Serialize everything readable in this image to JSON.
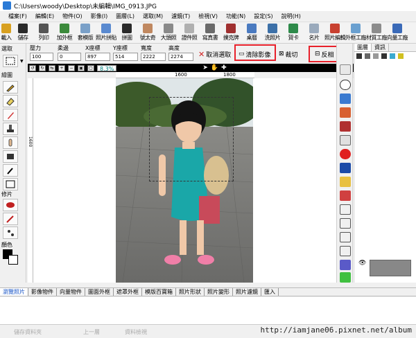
{
  "window": {
    "title": "C:\\Users\\woody\\Desktop\\未編輯\\IMG_0913.JPG"
  },
  "menu": [
    "檔案(F)",
    "編輯(E)",
    "物件(O)",
    "影像(I)",
    "圖層(L)",
    "選取(M)",
    "濾鏡(T)",
    "檢視(V)",
    "功能(N)",
    "設定(S)",
    "說明(H)"
  ],
  "toolbar": [
    {
      "label": "載入",
      "color": "#d8a020"
    },
    {
      "label": "儲存",
      "color": "#2a2a2a"
    },
    {
      "label": "列印",
      "color": "#555555"
    },
    {
      "label": "加外框",
      "color": "#3c8a3c"
    },
    {
      "label": "套模版",
      "color": "#7aa0c8"
    },
    {
      "label": "照片拼貼",
      "color": "#5a8ad0"
    },
    {
      "label": "拼圖",
      "color": "#2a2a2a"
    },
    {
      "label": "號太奇",
      "color": "#c08860"
    },
    {
      "label": "大頭照",
      "color": "#8a8a8a"
    },
    {
      "label": "證件照",
      "color": "#b0b0b0"
    },
    {
      "label": "寫真書",
      "color": "#6a6a6a"
    },
    {
      "label": "撲克牌",
      "color": "#a03030"
    },
    {
      "label": "桌曆",
      "color": "#4a7ac0"
    },
    {
      "label": "洗照片",
      "color": "#3c70a8"
    },
    {
      "label": "賀卡",
      "color": "#2e8a4a"
    },
    {
      "label": "名片",
      "color": "#9aaabc"
    },
    {
      "label": "照片編輯",
      "color": "#c84030"
    },
    {
      "label": "外框工廠",
      "color": "#6aa0d0"
    },
    {
      "label": "材質工廠",
      "color": "#8c8c8c"
    },
    {
      "label": "向量工廠",
      "color": "#3a6ab8"
    }
  ],
  "params": {
    "pressure": {
      "label": "壓力",
      "value": "100"
    },
    "softness": {
      "label": "柔邊",
      "value": "0"
    },
    "x_coord": {
      "label": "X座標",
      "value": "897"
    },
    "y_coord": {
      "label": "Y座標",
      "value": "514"
    },
    "width": {
      "label": "寬度",
      "value": "2222"
    },
    "height": {
      "label": "高度",
      "value": "2274"
    },
    "unit": "PIXEL",
    "cancel_select": "取消選取",
    "clear_image": "清除影像",
    "crop": "裁切",
    "invert": "反相",
    "object_label": "物"
  },
  "imagebar": {
    "zoom": "8.3%",
    "ruler_marks": [
      "1600",
      "1800"
    ],
    "ruler_left": "1600"
  },
  "leftpanel": {
    "select_label": "選取",
    "draw_label": "繪圖",
    "retouch_label": "修片",
    "color_label": "顏色",
    "fg_color": "#000000",
    "bg_color": "#ffffff"
  },
  "layerpanel": {
    "tabs": [
      "圖層",
      "資訊"
    ]
  },
  "bottomtabs": [
    "瀏覽照片",
    "影像物件",
    "向量物件",
    "圖面外框",
    "遮罩外框",
    "模版百寶箱",
    "照片形狀",
    "照片變形",
    "照片濾鏡",
    "匯入"
  ],
  "watermark": "http://iamjane06.pixnet.net/album",
  "status": {
    "left": "儲存資料夾",
    "middle": "上一層",
    "right": "資料檢視"
  }
}
